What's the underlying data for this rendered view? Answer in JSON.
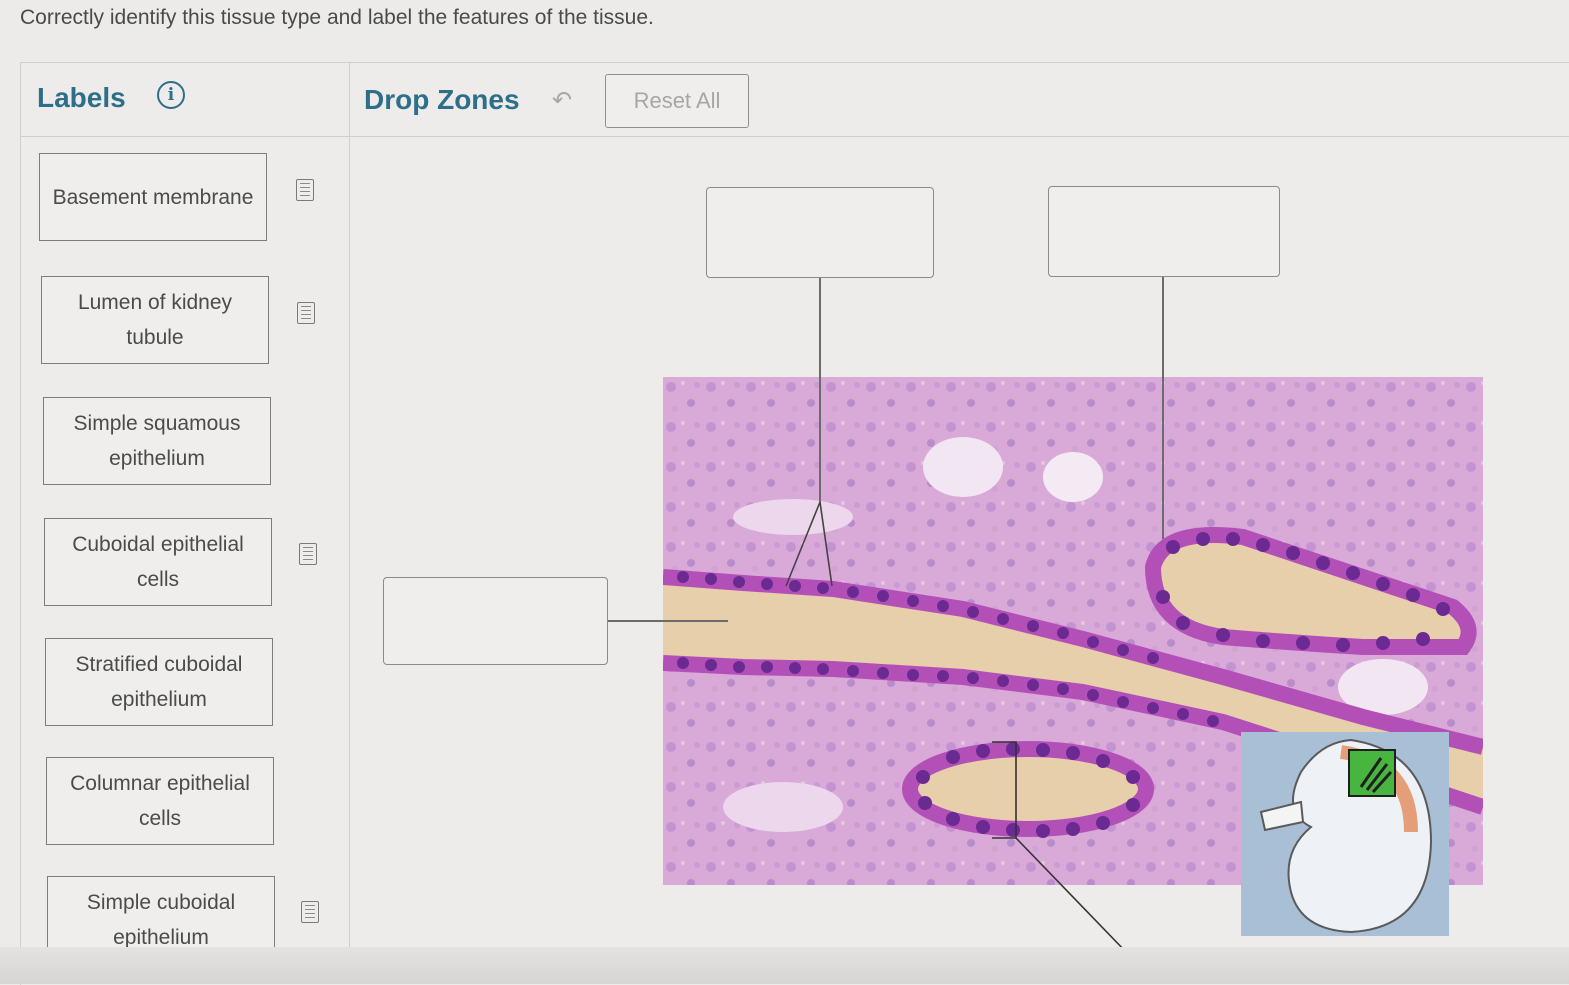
{
  "instruction": "Correctly identify this tissue type and label the features of the tissue.",
  "labels_panel": {
    "title": "Labels",
    "info_icon": "info-icon",
    "items": [
      {
        "label": "Basement membrane",
        "icon": "hint-doc-icon"
      },
      {
        "label": "Lumen of kidney tubule",
        "icon": "hint-doc-icon"
      },
      {
        "label": "Simple squamous epithelium",
        "icon": null
      },
      {
        "label": "Cuboidal epithelial cells",
        "icon": "hint-doc-icon"
      },
      {
        "label": "Stratified cuboidal epithelium",
        "icon": null
      },
      {
        "label": "Columnar epithelial cells",
        "icon": null
      },
      {
        "label": "Simple cuboidal epithelium",
        "icon": "hint-doc-icon"
      }
    ]
  },
  "drop_panel": {
    "title": "Drop Zones",
    "undo_icon": "undo-arrow-icon",
    "reset_label": "Reset All",
    "zones": [
      "",
      "",
      "",
      ""
    ]
  },
  "colors": {
    "accent": "#2d6f88",
    "tissue_pink": "#d6a3d4",
    "nucleus_purple": "#7a2f9c",
    "lumen_tan": "#e5ccaa"
  }
}
